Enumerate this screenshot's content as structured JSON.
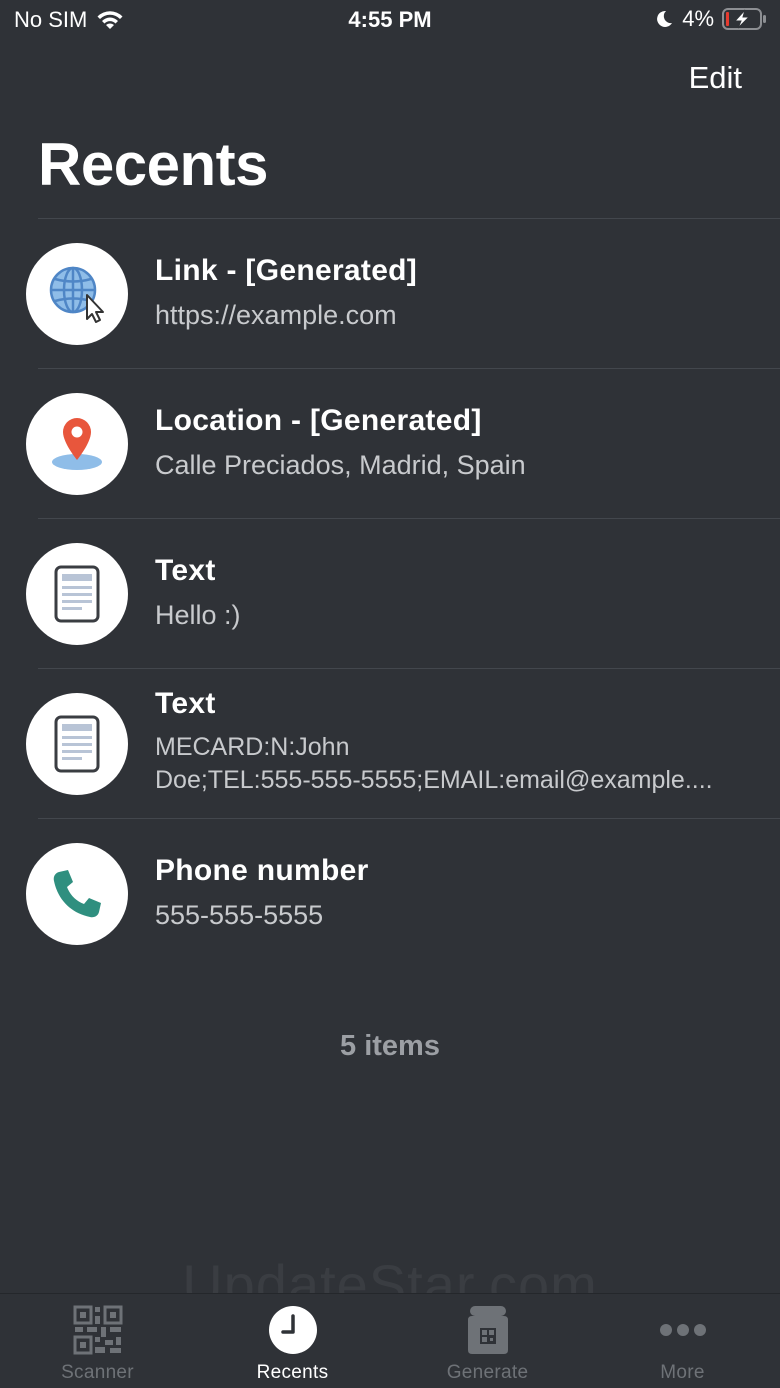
{
  "status_bar": {
    "carrier": "No SIM",
    "time": "4:55 PM",
    "battery": "4%"
  },
  "nav": {
    "edit_label": "Edit",
    "title": "Recents"
  },
  "items": [
    {
      "icon": "globe-icon",
      "title": "Link - [Generated]",
      "subtitle": "https://example.com"
    },
    {
      "icon": "location-pin-icon",
      "title": "Location - [Generated]",
      "subtitle": "Calle Preciados, Madrid, Spain"
    },
    {
      "icon": "document-icon",
      "title": "Text",
      "subtitle": "Hello :)"
    },
    {
      "icon": "document-icon",
      "title": "Text",
      "subtitle_lines": [
        "MECARD:N:John",
        "Doe;TEL:555-555-5555;EMAIL:email@example...."
      ]
    },
    {
      "icon": "phone-icon",
      "title": "Phone number",
      "subtitle": "555-555-5555"
    }
  ],
  "item_count": "5 items",
  "watermark": "UpdateStar.com",
  "tabs": [
    {
      "label": "Scanner",
      "icon": "qr-code-icon",
      "active": false
    },
    {
      "label": "Recents",
      "icon": "clock-icon",
      "active": true
    },
    {
      "label": "Generate",
      "icon": "qr-jar-icon",
      "active": false
    },
    {
      "label": "More",
      "icon": "more-dots-icon",
      "active": false
    }
  ],
  "colors": {
    "background": "#2f3237",
    "divider": "#43474d",
    "subtitle": "#c8cacd",
    "tab_inactive": "#6e7277",
    "phone_icon": "#2f8f7f",
    "globe_icon": "#6fa3dc",
    "pin_icon": "#e8563c"
  }
}
